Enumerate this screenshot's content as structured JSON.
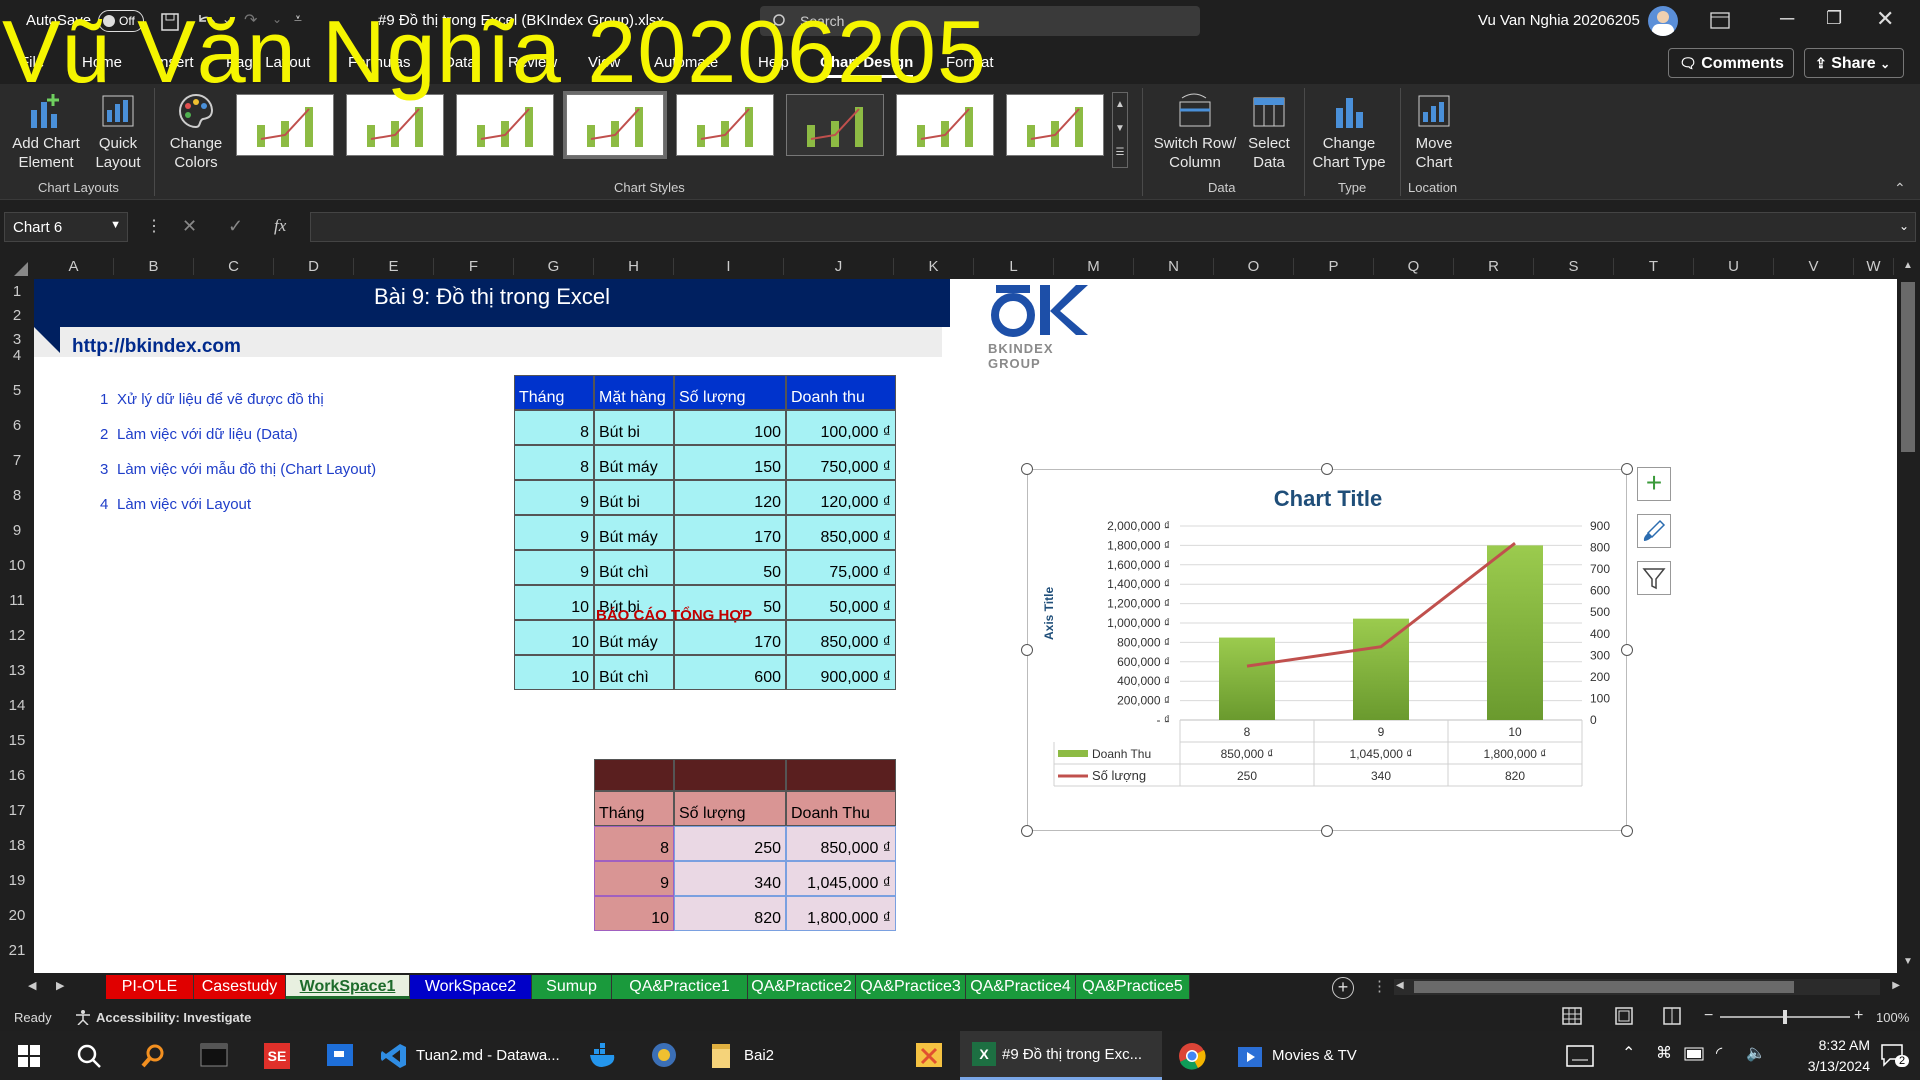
{
  "titlebar": {
    "autosave_label": "AutoSave",
    "autosave_state": "Off",
    "doc_title": "#9 Đồ thị trong Excel (BKIndex Group).xlsx",
    "search_placeholder": "Search",
    "user_name": "Vu Van Nghia 20206205"
  },
  "watermark": "Vũ Văn Nghĩa 20206205",
  "tabs": [
    "File",
    "Home",
    "Insert",
    "Page Layout",
    "Formulas",
    "Data",
    "Review",
    "View",
    "Automate",
    "Help",
    "Chart Design",
    "Format"
  ],
  "header_buttons": {
    "comments": "Comments",
    "share": "Share"
  },
  "ribbon": {
    "add_chart_element": "Add Chart\nElement",
    "quick_layout": "Quick\nLayout",
    "change_colors": "Change\nColors",
    "chart_layouts_group": "Chart Layouts",
    "chart_styles_group": "Chart Styles",
    "switch_row_col": "Switch Row/\nColumn",
    "select_data": "Select\nData",
    "data_group": "Data",
    "change_chart_type": "Change\nChart Type",
    "type_group": "Type",
    "move_chart": "Move\nChart",
    "location_group": "Location"
  },
  "formula_bar": {
    "name_box": "Chart 6",
    "fx": "fx"
  },
  "columns": [
    "A",
    "B",
    "C",
    "D",
    "E",
    "F",
    "G",
    "H",
    "I",
    "J",
    "K",
    "L",
    "M",
    "N",
    "O",
    "P",
    "Q",
    "R",
    "S",
    "T",
    "U",
    "V",
    "W"
  ],
  "rows": [
    "1",
    "2",
    "3",
    "4",
    "5",
    "6",
    "7",
    "8",
    "9",
    "10",
    "11",
    "12",
    "13",
    "14",
    "15",
    "16",
    "17",
    "18",
    "19",
    "20",
    "21"
  ],
  "sheet": {
    "banner_title": "Bài 9:  Đồ thị trong Excel",
    "url": "http://bkindex.com",
    "logo_text": "BKINDEX GROUP",
    "steps": [
      {
        "n": "1",
        "t": "Xử lý dữ liệu để vẽ được đồ thị"
      },
      {
        "n": "2",
        "t": "Làm việc với dữ liệu (Data)"
      },
      {
        "n": "3",
        "t": "Làm việc với mẫu đồ thị (Chart Layout)"
      },
      {
        "n": "4",
        "t": "Làm việc với Layout"
      }
    ],
    "table1_headers": [
      "Tháng",
      "Mặt hàng",
      "Số lượng",
      "Doanh thu"
    ],
    "table1_rows": [
      [
        "8",
        "Bút bi",
        "100",
        "100,000 ₫"
      ],
      [
        "8",
        "Bút máy",
        "150",
        "750,000 ₫"
      ],
      [
        "9",
        "Bút bi",
        "120",
        "120,000 ₫"
      ],
      [
        "9",
        "Bút máy",
        "170",
        "850,000 ₫"
      ],
      [
        "9",
        "Bút chì",
        "50",
        "75,000 ₫"
      ],
      [
        "10",
        "Bút bi",
        "50",
        "50,000 ₫"
      ],
      [
        "10",
        "Bút máy",
        "170",
        "850,000 ₫"
      ],
      [
        "10",
        "Bút chì",
        "600",
        "900,000 ₫"
      ]
    ],
    "report_title": "BÁO CÁO TỔNG HỢP",
    "table2_headers": [
      "Tháng",
      "Số lượng",
      "Doanh Thu"
    ],
    "table2_rows": [
      [
        "8",
        "250",
        "850,000 ₫"
      ],
      [
        "9",
        "340",
        "1,045,000 ₫"
      ],
      [
        "10",
        "820",
        "1,800,000 ₫"
      ]
    ]
  },
  "chart_data": {
    "type": "bar",
    "title": "Chart Title",
    "ylabel": "Axis Title",
    "categories": [
      "8",
      "9",
      "10"
    ],
    "ylim": [
      0,
      2000000
    ],
    "y2lim": [
      0,
      900
    ],
    "y_ticks": [
      "2,000,000 ₫",
      "1,800,000 ₫",
      "1,600,000 ₫",
      "1,400,000 ₫",
      "1,200,000 ₫",
      "1,000,000 ₫",
      "800,000 ₫",
      "600,000 ₫",
      "400,000 ₫",
      "200,000 ₫",
      "- ₫"
    ],
    "y2_ticks": [
      "900",
      "800",
      "700",
      "600",
      "500",
      "400",
      "300",
      "200",
      "100",
      "0"
    ],
    "series": [
      {
        "name": "Doanh Thu",
        "kind": "bar",
        "values": [
          850000,
          1045000,
          1800000
        ],
        "labels": [
          "850,000 ₫",
          "1,045,000 ₫",
          "1,800,000 ₫"
        ],
        "color": "#8dbb44"
      },
      {
        "name": "Số lượng",
        "kind": "line",
        "axis": "secondary",
        "values": [
          250,
          340,
          820
        ],
        "labels": [
          "250",
          "340",
          "820"
        ],
        "color": "#c0504d"
      }
    ],
    "grid": true,
    "legend": "data-table"
  },
  "sheet_tabs": [
    {
      "label": "PI-O'LE",
      "bg": "#e00000",
      "fg": "#ffffff"
    },
    {
      "label": "Casestudy",
      "bg": "#e00000",
      "fg": "#ffffff"
    },
    {
      "label": "WorkSpace1",
      "bg": "#e8f0e0",
      "fg": "#1d6b2b"
    },
    {
      "label": "WorkSpace2",
      "bg": "#0000c8",
      "fg": "#ffffff"
    },
    {
      "label": "Sumup",
      "bg": "#1a9a3c",
      "fg": "#ffffff"
    },
    {
      "label": "QA&Practice1",
      "bg": "#1a9a3c",
      "fg": "#ffffff"
    },
    {
      "label": "QA&Practice2",
      "bg": "#1a9a3c",
      "fg": "#ffffff"
    },
    {
      "label": "QA&Practice3",
      "bg": "#1a9a3c",
      "fg": "#ffffff"
    },
    {
      "label": "QA&Practice4",
      "bg": "#1a9a3c",
      "fg": "#ffffff"
    },
    {
      "label": "QA&Practice5",
      "bg": "#1a9a3c",
      "fg": "#ffffff"
    }
  ],
  "status": {
    "ready": "Ready",
    "accessibility": "Accessibility: Investigate",
    "zoom": "100%"
  },
  "taskbar": {
    "vscode": "Tuan2.md - Datawa...",
    "folder": "Bai2",
    "excel": "#9 Đồ thị trong Exc...",
    "movies": "Movies & TV",
    "time": "8:32 AM",
    "date": "3/13/2024",
    "notif": "2"
  }
}
